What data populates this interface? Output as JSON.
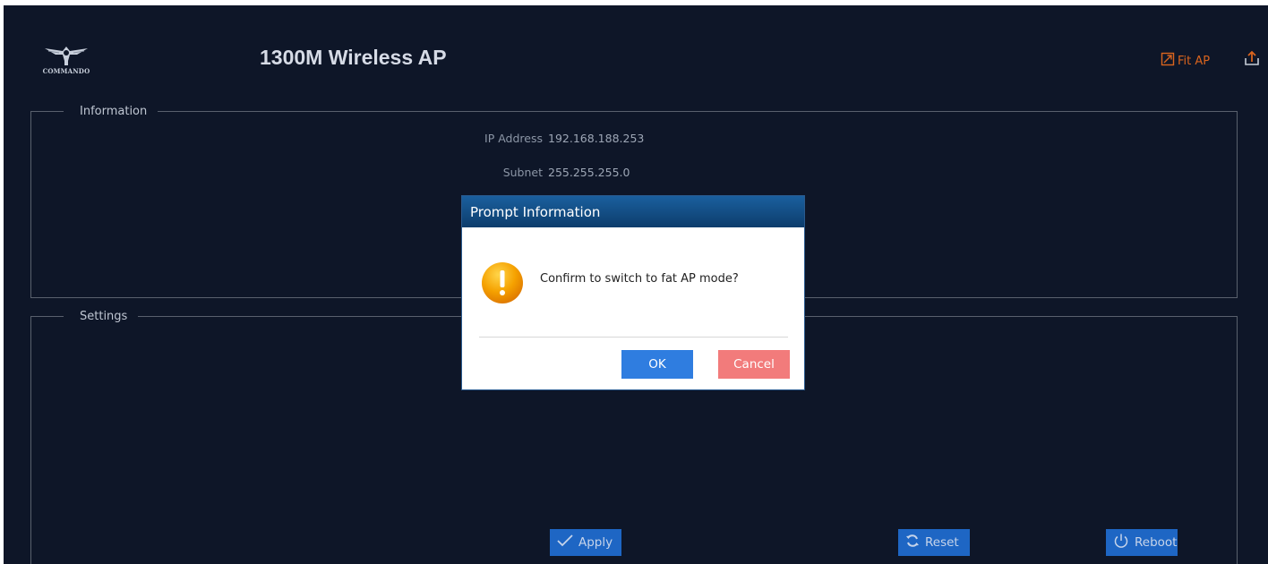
{
  "header": {
    "logo_text": "COMMANDO",
    "title": "1300M Wireless AP",
    "fit_ap_label": "Fit AP"
  },
  "information": {
    "legend": "Information",
    "ip_label": "IP Address",
    "ip_value": "192.168.188.253",
    "subnet_label": "Subnet",
    "subnet_value": "255.255.255.0"
  },
  "settings": {
    "legend": "Settings"
  },
  "actions": {
    "apply_label": "Apply",
    "reset_label": "Reset",
    "reboot_label": "Reboot"
  },
  "dialog": {
    "title": "Prompt Information",
    "message": "Confirm to switch to fat AP mode?",
    "ok_label": "OK",
    "cancel_label": "Cancel"
  },
  "colors": {
    "background": "#0e1628",
    "accent_orange": "#d9641e",
    "button_blue": "#1e66c4",
    "ok_blue": "#2f7de0",
    "cancel_red": "#f27b7b",
    "dialog_header": "#124d85",
    "warning": "#f5a100"
  },
  "icons": [
    "commando-logo-icon",
    "fit-ap-icon",
    "export-icon",
    "check-icon",
    "refresh-icon",
    "power-icon",
    "warning-icon"
  ]
}
